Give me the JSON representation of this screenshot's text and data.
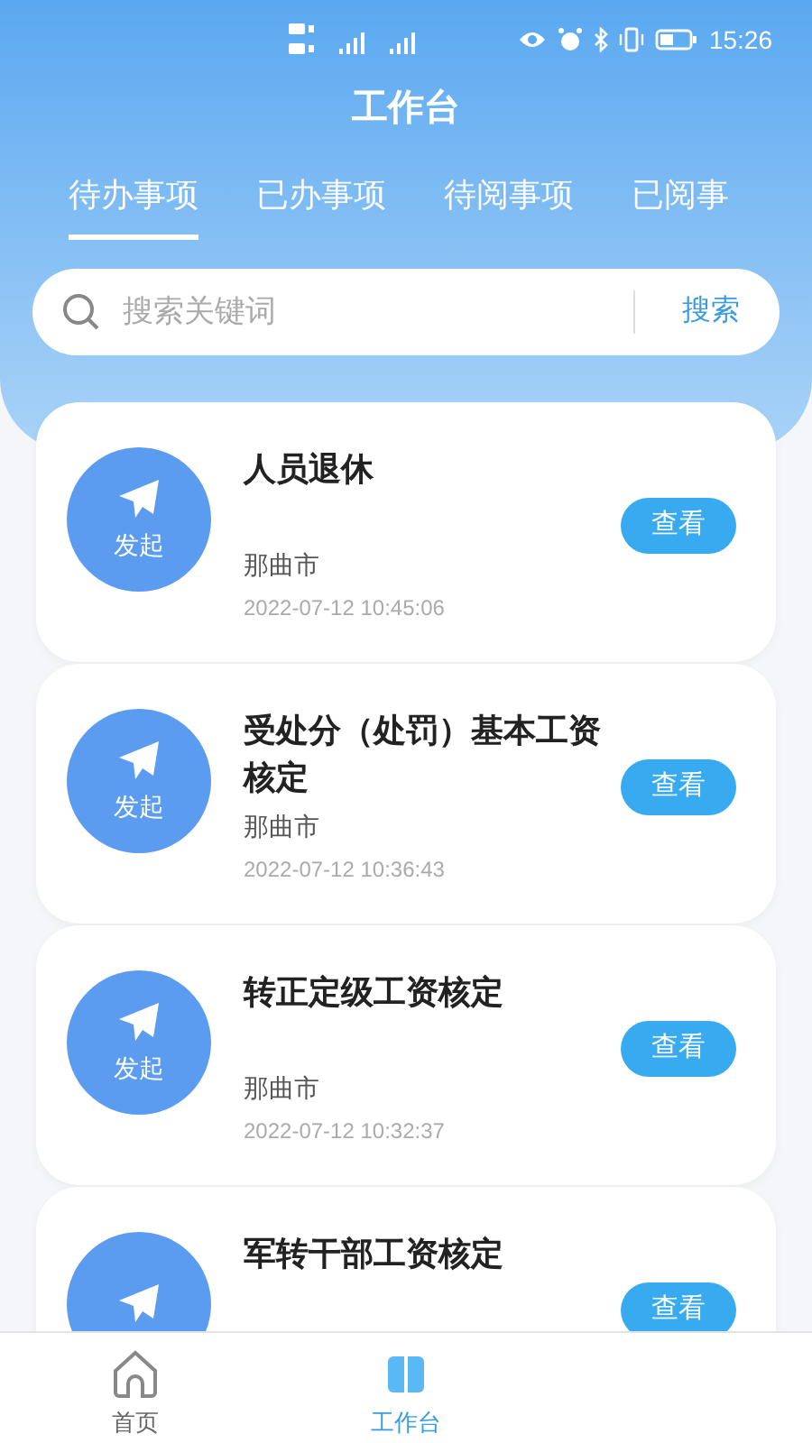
{
  "status_bar": {
    "time": "15:26"
  },
  "header": {
    "title": "工作台"
  },
  "tabs": [
    {
      "label": "待办事项",
      "selected": true
    },
    {
      "label": "已办事项",
      "selected": false
    },
    {
      "label": "待阅事项",
      "selected": false
    },
    {
      "label": "已阅事",
      "selected": false
    }
  ],
  "search": {
    "placeholder": "搜索关键词",
    "button": "搜索"
  },
  "items": [
    {
      "badge": "发起",
      "title": "人员退休",
      "location": "那曲市",
      "time": "2022-07-12 10:45:06",
      "action": "查看"
    },
    {
      "badge": "发起",
      "title": "受处分（处罚）基本工资核定",
      "location": "那曲市",
      "time": "2022-07-12 10:36:43",
      "action": "查看"
    },
    {
      "badge": "发起",
      "title": "转正定级工资核定",
      "location": "那曲市",
      "time": "2022-07-12 10:32:37",
      "action": "查看"
    },
    {
      "title": "军转干部工资核定",
      "action": "查看"
    }
  ],
  "bottom_nav": [
    {
      "label": "首页",
      "selected": false
    },
    {
      "label": "工作台",
      "selected": true
    }
  ]
}
